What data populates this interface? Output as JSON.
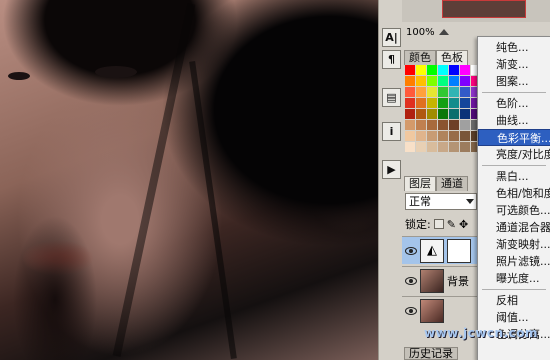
{
  "canvas": {
    "description_color_dark": "#050405"
  },
  "strip": {
    "buttons": [
      {
        "icon": "character-panel-icon",
        "glyph": "A|"
      },
      {
        "icon": "paragraph-panel-icon",
        "glyph": "¶"
      },
      {
        "icon": "notes-panel-icon",
        "glyph": "▤"
      },
      {
        "icon": "info-panel-icon",
        "glyph": "i"
      },
      {
        "icon": "actions-panel-icon",
        "glyph": "▶"
      }
    ]
  },
  "navigator": {
    "zoom": "100%"
  },
  "color_panel": {
    "tabs": [
      "颜色",
      "色板"
    ],
    "swatches": [
      "#ff0000",
      "#ffff00",
      "#00ff00",
      "#00ffff",
      "#0000ff",
      "#ff00ff",
      "#ffffff",
      "#ff3f3f",
      "#ff7f00",
      "#ffbf00",
      "#7fff00",
      "#00ff7f",
      "#007fff",
      "#7f00ff",
      "#ff007f",
      "#bfbfbf",
      "#ff5a3c",
      "#ffa03c",
      "#e6e632",
      "#32c832",
      "#32b4b4",
      "#325ac8",
      "#8c32c8",
      "#999999",
      "#e03020",
      "#e07020",
      "#c8b400",
      "#14a014",
      "#148c8c",
      "#14469b",
      "#6e14a0",
      "#7f7f7f",
      "#b02010",
      "#b05810",
      "#a08c00",
      "#0a780a",
      "#0a6e6e",
      "#0a3278",
      "#500a78",
      "#5a5a5a",
      "#d49a6a",
      "#c08050",
      "#a86a3c",
      "#8a5430",
      "#6e4028",
      "#a0a0a0",
      "#6a6a6a",
      "#3c3c3c",
      "#f0c8a0",
      "#e0b48c",
      "#c89c74",
      "#b0845c",
      "#986c48",
      "#7a5638",
      "#5a3e28",
      "#000000",
      "#f8e0c8",
      "#e8d0b4",
      "#d8bc9c",
      "#c8a888",
      "#b49474",
      "#9c7c5e",
      "#806448",
      "#2a2a2a"
    ]
  },
  "layers_panel": {
    "tabs": [
      "图层",
      "通道"
    ],
    "blend_mode": "正常",
    "lock_label": "锁定:",
    "layers": [
      {
        "name": "",
        "selected": true,
        "thumb": "#f4f4f4"
      },
      {
        "name": "背景",
        "selected": false,
        "thumb": "#6a4036"
      },
      {
        "name": "",
        "selected": false,
        "thumb": "#8a5040"
      }
    ]
  },
  "history_tab": "历史记录",
  "menu": {
    "groups": [
      [
        "纯色...",
        "渐变...",
        "图案..."
      ],
      [
        "色阶...",
        "曲线...",
        "色彩平衡...",
        "亮度/对比度..."
      ],
      [
        "黑白...",
        "色相/饱和度...",
        "可选颜色...",
        "通道混合器...",
        "渐变映射...",
        "照片滤镜...",
        "曝光度..."
      ],
      [
        "反相",
        "阈值...",
        "色调分离..."
      ]
    ],
    "highlighted": "色彩平衡..."
  },
  "watermark": "www.jcwcn.com"
}
